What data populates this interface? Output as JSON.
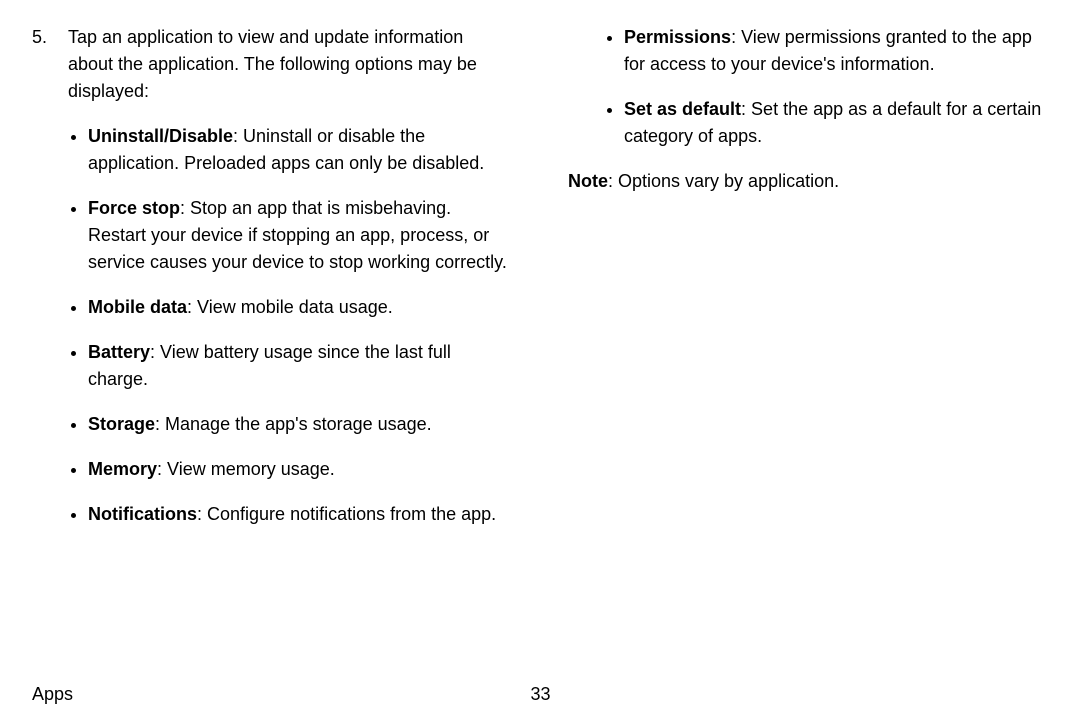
{
  "step": {
    "number": "5.",
    "intro": "Tap an application to view and update information about the application. The following options may be displayed:"
  },
  "bullets_col1": [
    {
      "label": "Uninstall/Disable",
      "text": ": Uninstall or disable the application. Preloaded apps can only be disabled."
    },
    {
      "label": "Force stop",
      "text": ": Stop an app that is misbehaving. Restart your device if stopping an app, process, or service causes your device to stop working correctly."
    },
    {
      "label": "Mobile data",
      "text": ": View mobile data usage."
    },
    {
      "label": "Battery",
      "text": ": View battery usage since the last full charge."
    },
    {
      "label": "Storage",
      "text": ": Manage the app's storage usage."
    },
    {
      "label": "Memory",
      "text": ": View memory usage."
    },
    {
      "label": "Notifications",
      "text": ": Configure notifications from the app."
    }
  ],
  "bullets_col2": [
    {
      "label": "Permissions",
      "text": ": View permissions granted to the app for access to your device's information."
    },
    {
      "label": "Set as default",
      "text": ": Set the app as a default for a certain category of apps."
    }
  ],
  "note": {
    "label": "Note",
    "text": ": Options vary by application."
  },
  "footer": {
    "section": "Apps",
    "page": "33"
  }
}
